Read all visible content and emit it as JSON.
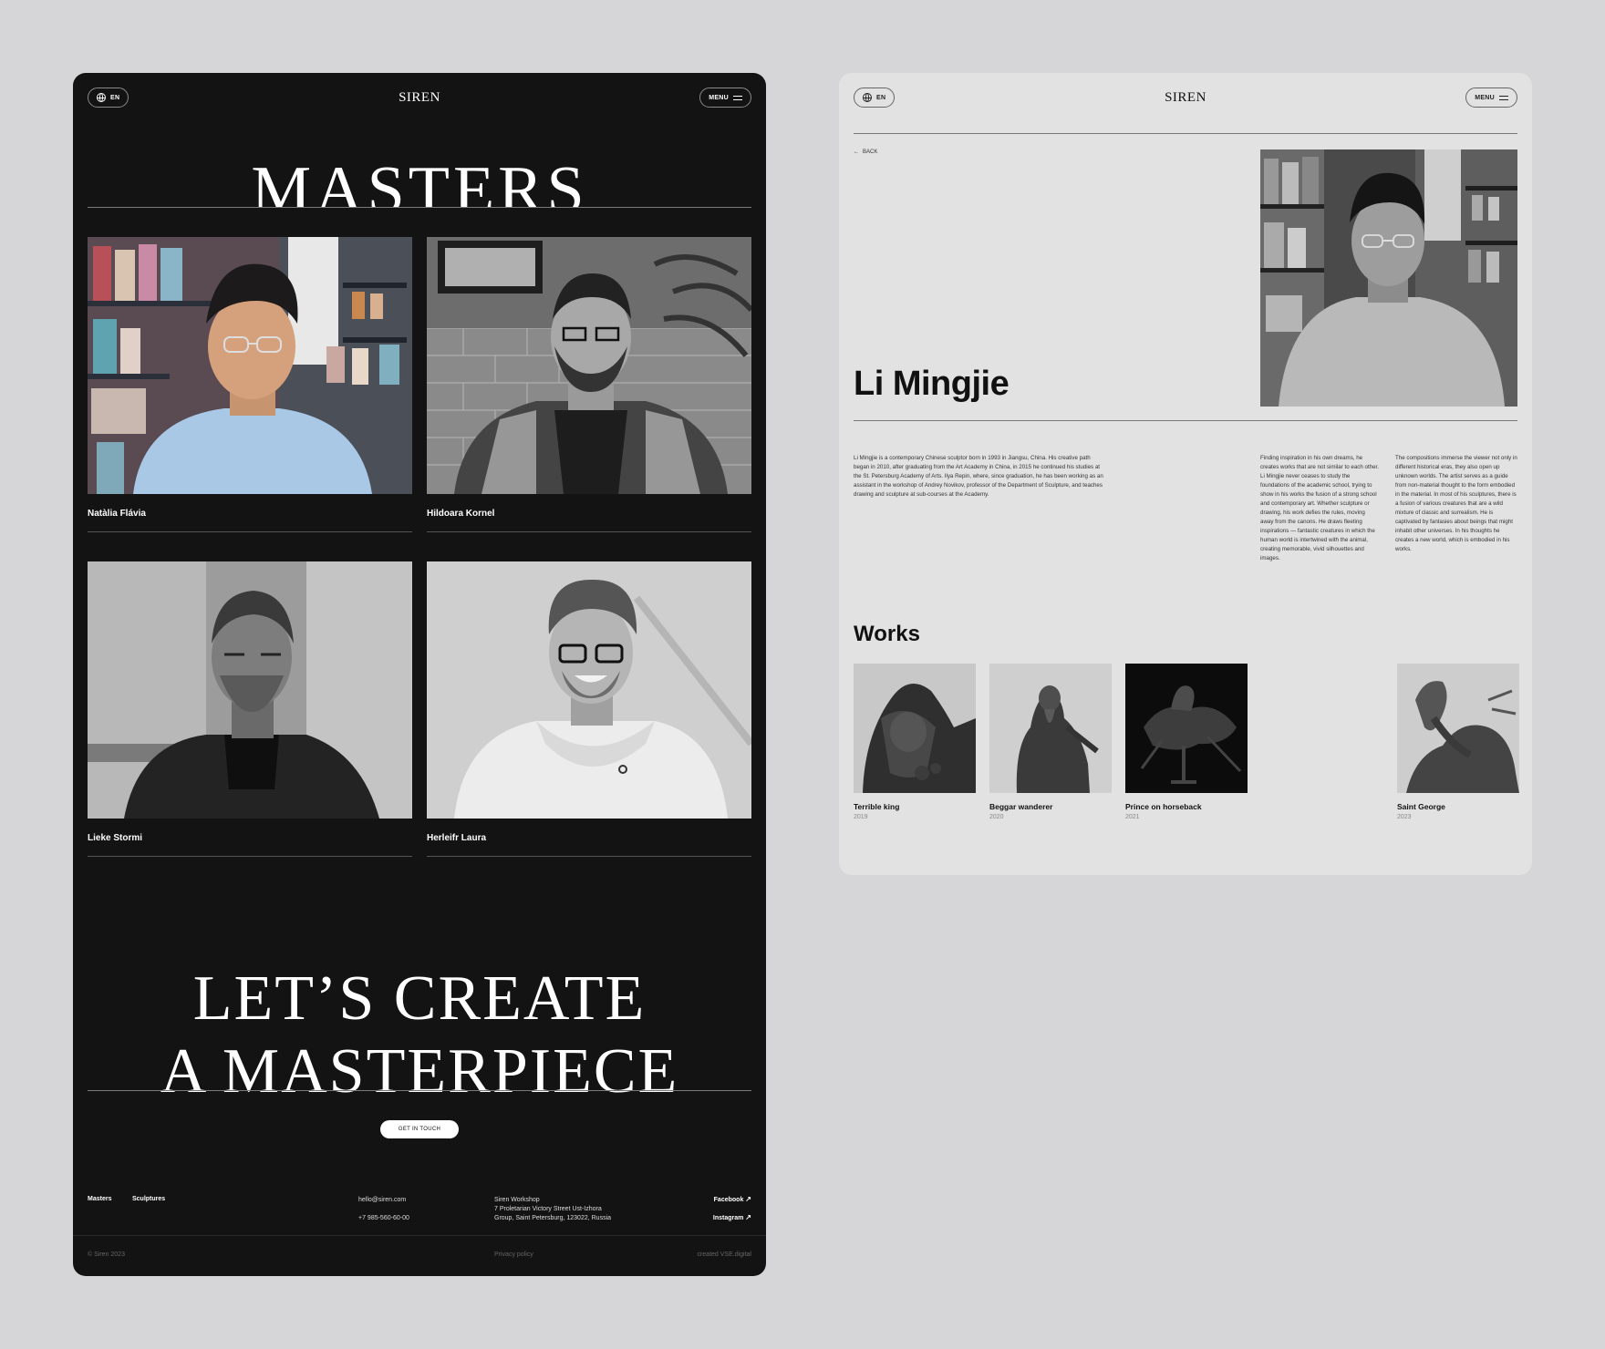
{
  "brand": "SIREN",
  "lang_label": "EN",
  "menu_label": "MENU",
  "masters_page": {
    "title": "MASTERS",
    "masters": [
      {
        "name": "Natàlia Flávia"
      },
      {
        "name": "Hildoara Kornel"
      },
      {
        "name": "Lieke Stormi"
      },
      {
        "name": "Herleifr Laura"
      }
    ],
    "cta_line1": "LET’S CREATE",
    "cta_line2": "A MASTERPIECE",
    "cta_button": "GET IN TOUCH",
    "footer": {
      "nav": [
        "Masters",
        "Sculptures"
      ],
      "email": "hello@siren.com",
      "phone": "+7 985-560-60-00",
      "address": [
        "Siren Workshop",
        "7 Proletarian Victory Street Ust-Izhora",
        "Group, Saint Petersburg, 123022, Russia"
      ],
      "social": [
        "Facebook",
        "Instagram"
      ],
      "copyright": "© Siren 2023",
      "privacy": "Privacy policy",
      "credit": "created VSE.digital"
    }
  },
  "detail_page": {
    "back_label": "BACK",
    "name": "Li Mingjie",
    "bio_col1": "Li Mingjie is a contemporary Chinese sculptor born in 1993 in Jiangsu, China. His creative path began in 2010, after graduating from the Art Academy in China, in 2015 he continued his studies at the St. Petersburg Academy of Arts. Ilya Repin, where, since graduation, he has been working as an assistant in the workshop of Andrey Novikov, professor of the Department of Sculpture, and teaches drawing and sculpture at sub-courses at the Academy.",
    "bio_col2": "Finding inspiration in his own dreams, he creates works that are not similar to each other. Li Mingjie never ceases to study the foundations of the academic school, trying to show in his works the fusion of a strong school and contemporary art. Whether sculpture or drawing, his work defies the rules, moving away from the canons. He draws fleeting inspirations — fantastic creatures in which the human world is intertwined with the animal, creating memorable, vivid silhouettes and images.",
    "bio_col3": "The compositions immerse the viewer not only in different historical eras, they also open up unknown worlds. The artist serves as a guide from non-material thought to the form embodied in the material. In most of his sculptures, there is a fusion of various creatures that are a wild mixture of classic and surrealism. He is captivated by fantasies about beings that might inhabit other universes. In his thoughts he creates a new world, which is embodied in his works.",
    "works_title": "Works",
    "works": [
      {
        "title": "Terrible king",
        "year": "2019"
      },
      {
        "title": "Beggar wanderer",
        "year": "2020"
      },
      {
        "title": "Prince on horseback",
        "year": "2021"
      },
      {
        "title": "Saint George",
        "year": "2023"
      }
    ]
  }
}
